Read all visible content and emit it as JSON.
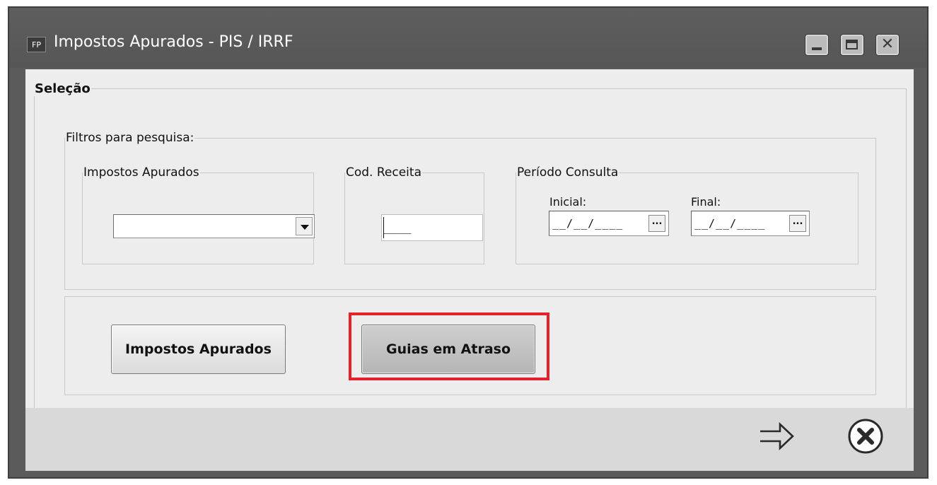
{
  "window": {
    "icon_text": "FP",
    "title": "Impostos Apurados - PIS / IRRF",
    "controls": [
      "minimize-icon",
      "maximize-icon",
      "close-icon"
    ]
  },
  "selecao": {
    "legend": "Seleção",
    "filtros": {
      "legend": "Filtros para pesquisa:",
      "impostos": {
        "legend": "Impostos Apurados",
        "value": ""
      },
      "codigo": {
        "legend": "Cod. Receita",
        "value": "____"
      },
      "periodo": {
        "legend": "Período Consulta",
        "inicial_label": "Inicial:",
        "inicial_value": "__/__/____",
        "final_label": "Final:",
        "final_value": "__/__/____",
        "picker_label": "..."
      }
    },
    "buttons": {
      "impostos_apurados": "Impostos Apurados",
      "guias_em_atraso": "Guias em Atraso"
    }
  },
  "footer": {
    "confirm_icon": "arrow-right-icon",
    "cancel_icon": "cancel-circle-icon"
  },
  "colors": {
    "titlebar": "#5b5b5b",
    "client": "#ededed",
    "highlight": "#e6202b"
  }
}
